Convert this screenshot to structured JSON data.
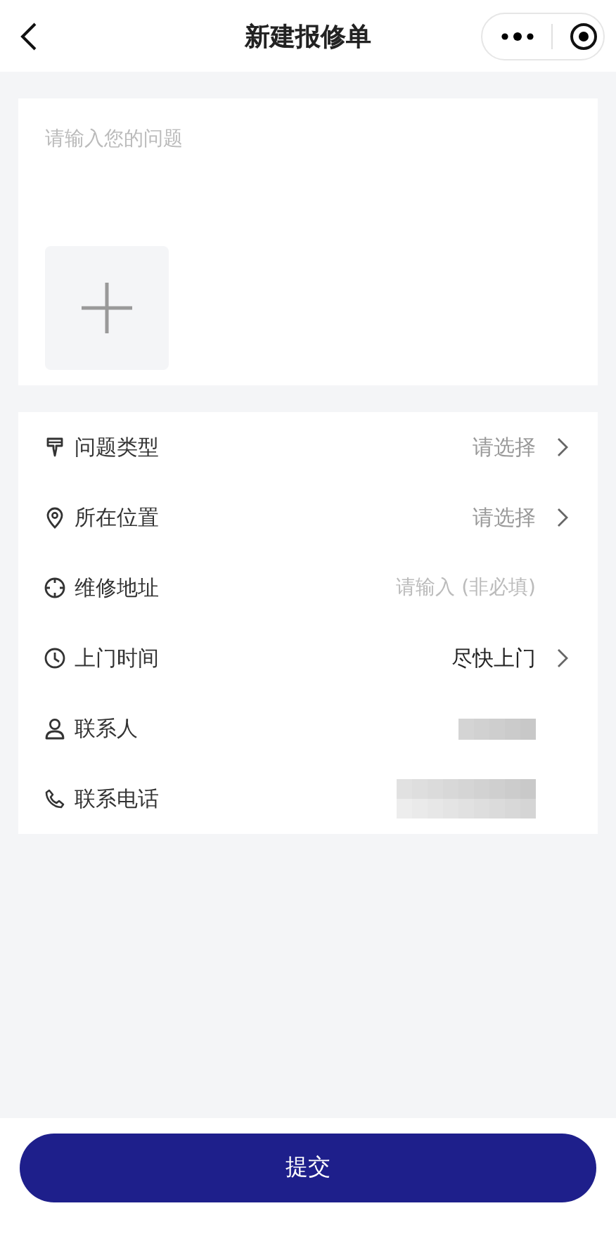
{
  "nav_bar": {
    "title": "新建报修单"
  },
  "problem": {
    "placeholder": "请输入您的问题"
  },
  "fields": [
    {
      "kind": "select",
      "label": "问题类型",
      "placeholder": "请选择"
    },
    {
      "kind": "select",
      "label": "所在位置",
      "placeholder": "请选择"
    },
    {
      "kind": "input",
      "label": "维修地址",
      "placeholder": "请输入 (非必填)"
    },
    {
      "kind": "select",
      "label": "上门时间",
      "value": "尽快上门"
    },
    {
      "kind": "redacted",
      "label": "联系人"
    },
    {
      "kind": "redacted",
      "label": "联系电话"
    }
  ],
  "submit_button": "提交"
}
